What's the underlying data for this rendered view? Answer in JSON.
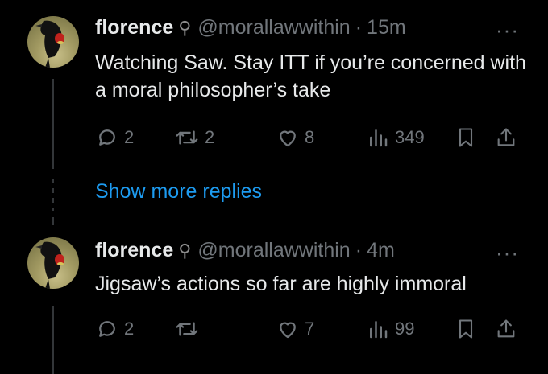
{
  "tweets": [
    {
      "name": "florence",
      "badge": "⚲",
      "handle": "@morallawwithin",
      "separator": "·",
      "time": "15m",
      "more": "···",
      "text": "Watching Saw. Stay ITT if you’re concerned with a moral philosopher’s take",
      "replies": "2",
      "retweets": "2",
      "likes": "8",
      "views": "349"
    },
    {
      "name": "florence",
      "badge": "⚲",
      "handle": "@morallawwithin",
      "separator": "·",
      "time": "4m",
      "more": "···",
      "text": "Jigsaw’s actions so far are highly immoral",
      "replies": "2",
      "retweets": "",
      "likes": "7",
      "views": "99"
    }
  ],
  "show_more": "Show more replies",
  "colors": {
    "background": "#000000",
    "text": "#e7e9ea",
    "muted": "#71767b",
    "link": "#1d9bf0"
  },
  "icons": [
    "reply-icon",
    "retweet-icon",
    "like-icon",
    "views-icon",
    "bookmark-icon",
    "share-icon"
  ]
}
